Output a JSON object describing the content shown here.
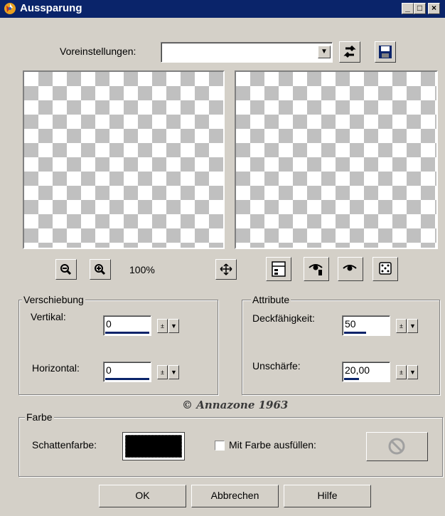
{
  "window": {
    "title": "Aussparung",
    "title_bar_color": "#0a246a"
  },
  "title_buttons": {
    "minimize": "_",
    "maximize": "□",
    "close": "×"
  },
  "presets": {
    "label": "Voreinstellungen:",
    "value": ""
  },
  "zoom": {
    "level": "100%"
  },
  "displacement": {
    "legend": "Verschiebung",
    "vertical_label": "Vertikal:",
    "vertical_value": "0",
    "horizontal_label": "Horizontal:",
    "horizontal_value": "0"
  },
  "attributes": {
    "legend": "Attribute",
    "opacity_label": "Deckfähigkeit:",
    "opacity_value": "50",
    "blur_label": "Unschärfe:",
    "blur_value": "20,00"
  },
  "watermark": "© Annazone 1963",
  "color": {
    "legend": "Farbe",
    "shadow_label": "Schattenfarbe:",
    "shadow_swatch": "#000000",
    "fill_label": "Mit Farbe ausfüllen:",
    "fill_checked": false
  },
  "buttons": {
    "ok": "OK",
    "cancel": "Abbrechen",
    "help": "Hilfe"
  }
}
